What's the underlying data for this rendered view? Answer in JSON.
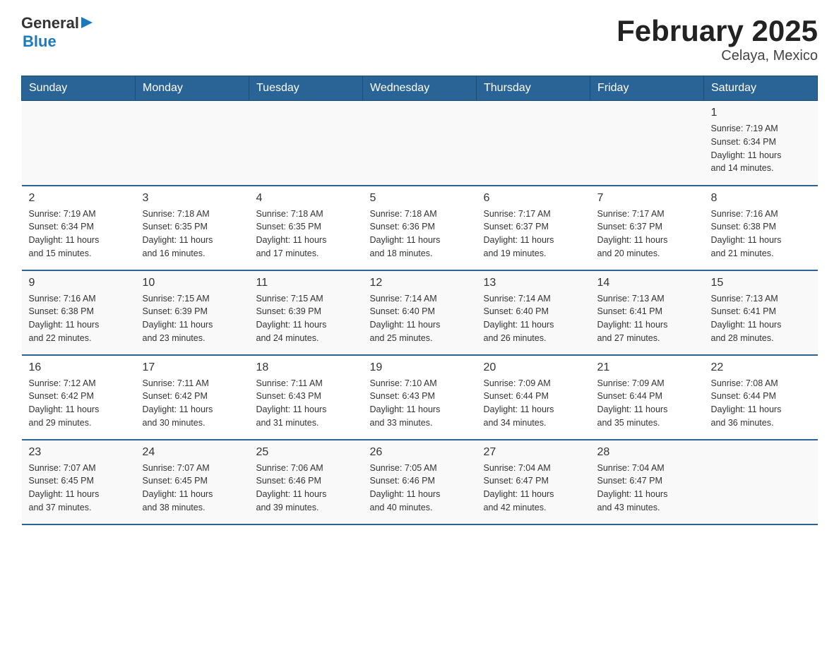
{
  "header": {
    "logo": {
      "general": "General",
      "arrow": "▶",
      "blue": "Blue"
    },
    "title": "February 2025",
    "subtitle": "Celaya, Mexico"
  },
  "days_of_week": [
    "Sunday",
    "Monday",
    "Tuesday",
    "Wednesday",
    "Thursday",
    "Friday",
    "Saturday"
  ],
  "weeks": [
    {
      "cells": [
        {
          "day": "",
          "info": ""
        },
        {
          "day": "",
          "info": ""
        },
        {
          "day": "",
          "info": ""
        },
        {
          "day": "",
          "info": ""
        },
        {
          "day": "",
          "info": ""
        },
        {
          "day": "",
          "info": ""
        },
        {
          "day": "1",
          "info": "Sunrise: 7:19 AM\nSunset: 6:34 PM\nDaylight: 11 hours\nand 14 minutes."
        }
      ]
    },
    {
      "cells": [
        {
          "day": "2",
          "info": "Sunrise: 7:19 AM\nSunset: 6:34 PM\nDaylight: 11 hours\nand 15 minutes."
        },
        {
          "day": "3",
          "info": "Sunrise: 7:18 AM\nSunset: 6:35 PM\nDaylight: 11 hours\nand 16 minutes."
        },
        {
          "day": "4",
          "info": "Sunrise: 7:18 AM\nSunset: 6:35 PM\nDaylight: 11 hours\nand 17 minutes."
        },
        {
          "day": "5",
          "info": "Sunrise: 7:18 AM\nSunset: 6:36 PM\nDaylight: 11 hours\nand 18 minutes."
        },
        {
          "day": "6",
          "info": "Sunrise: 7:17 AM\nSunset: 6:37 PM\nDaylight: 11 hours\nand 19 minutes."
        },
        {
          "day": "7",
          "info": "Sunrise: 7:17 AM\nSunset: 6:37 PM\nDaylight: 11 hours\nand 20 minutes."
        },
        {
          "day": "8",
          "info": "Sunrise: 7:16 AM\nSunset: 6:38 PM\nDaylight: 11 hours\nand 21 minutes."
        }
      ]
    },
    {
      "cells": [
        {
          "day": "9",
          "info": "Sunrise: 7:16 AM\nSunset: 6:38 PM\nDaylight: 11 hours\nand 22 minutes."
        },
        {
          "day": "10",
          "info": "Sunrise: 7:15 AM\nSunset: 6:39 PM\nDaylight: 11 hours\nand 23 minutes."
        },
        {
          "day": "11",
          "info": "Sunrise: 7:15 AM\nSunset: 6:39 PM\nDaylight: 11 hours\nand 24 minutes."
        },
        {
          "day": "12",
          "info": "Sunrise: 7:14 AM\nSunset: 6:40 PM\nDaylight: 11 hours\nand 25 minutes."
        },
        {
          "day": "13",
          "info": "Sunrise: 7:14 AM\nSunset: 6:40 PM\nDaylight: 11 hours\nand 26 minutes."
        },
        {
          "day": "14",
          "info": "Sunrise: 7:13 AM\nSunset: 6:41 PM\nDaylight: 11 hours\nand 27 minutes."
        },
        {
          "day": "15",
          "info": "Sunrise: 7:13 AM\nSunset: 6:41 PM\nDaylight: 11 hours\nand 28 minutes."
        }
      ]
    },
    {
      "cells": [
        {
          "day": "16",
          "info": "Sunrise: 7:12 AM\nSunset: 6:42 PM\nDaylight: 11 hours\nand 29 minutes."
        },
        {
          "day": "17",
          "info": "Sunrise: 7:11 AM\nSunset: 6:42 PM\nDaylight: 11 hours\nand 30 minutes."
        },
        {
          "day": "18",
          "info": "Sunrise: 7:11 AM\nSunset: 6:43 PM\nDaylight: 11 hours\nand 31 minutes."
        },
        {
          "day": "19",
          "info": "Sunrise: 7:10 AM\nSunset: 6:43 PM\nDaylight: 11 hours\nand 33 minutes."
        },
        {
          "day": "20",
          "info": "Sunrise: 7:09 AM\nSunset: 6:44 PM\nDaylight: 11 hours\nand 34 minutes."
        },
        {
          "day": "21",
          "info": "Sunrise: 7:09 AM\nSunset: 6:44 PM\nDaylight: 11 hours\nand 35 minutes."
        },
        {
          "day": "22",
          "info": "Sunrise: 7:08 AM\nSunset: 6:44 PM\nDaylight: 11 hours\nand 36 minutes."
        }
      ]
    },
    {
      "cells": [
        {
          "day": "23",
          "info": "Sunrise: 7:07 AM\nSunset: 6:45 PM\nDaylight: 11 hours\nand 37 minutes."
        },
        {
          "day": "24",
          "info": "Sunrise: 7:07 AM\nSunset: 6:45 PM\nDaylight: 11 hours\nand 38 minutes."
        },
        {
          "day": "25",
          "info": "Sunrise: 7:06 AM\nSunset: 6:46 PM\nDaylight: 11 hours\nand 39 minutes."
        },
        {
          "day": "26",
          "info": "Sunrise: 7:05 AM\nSunset: 6:46 PM\nDaylight: 11 hours\nand 40 minutes."
        },
        {
          "day": "27",
          "info": "Sunrise: 7:04 AM\nSunset: 6:47 PM\nDaylight: 11 hours\nand 42 minutes."
        },
        {
          "day": "28",
          "info": "Sunrise: 7:04 AM\nSunset: 6:47 PM\nDaylight: 11 hours\nand 43 minutes."
        },
        {
          "day": "",
          "info": ""
        }
      ]
    }
  ]
}
